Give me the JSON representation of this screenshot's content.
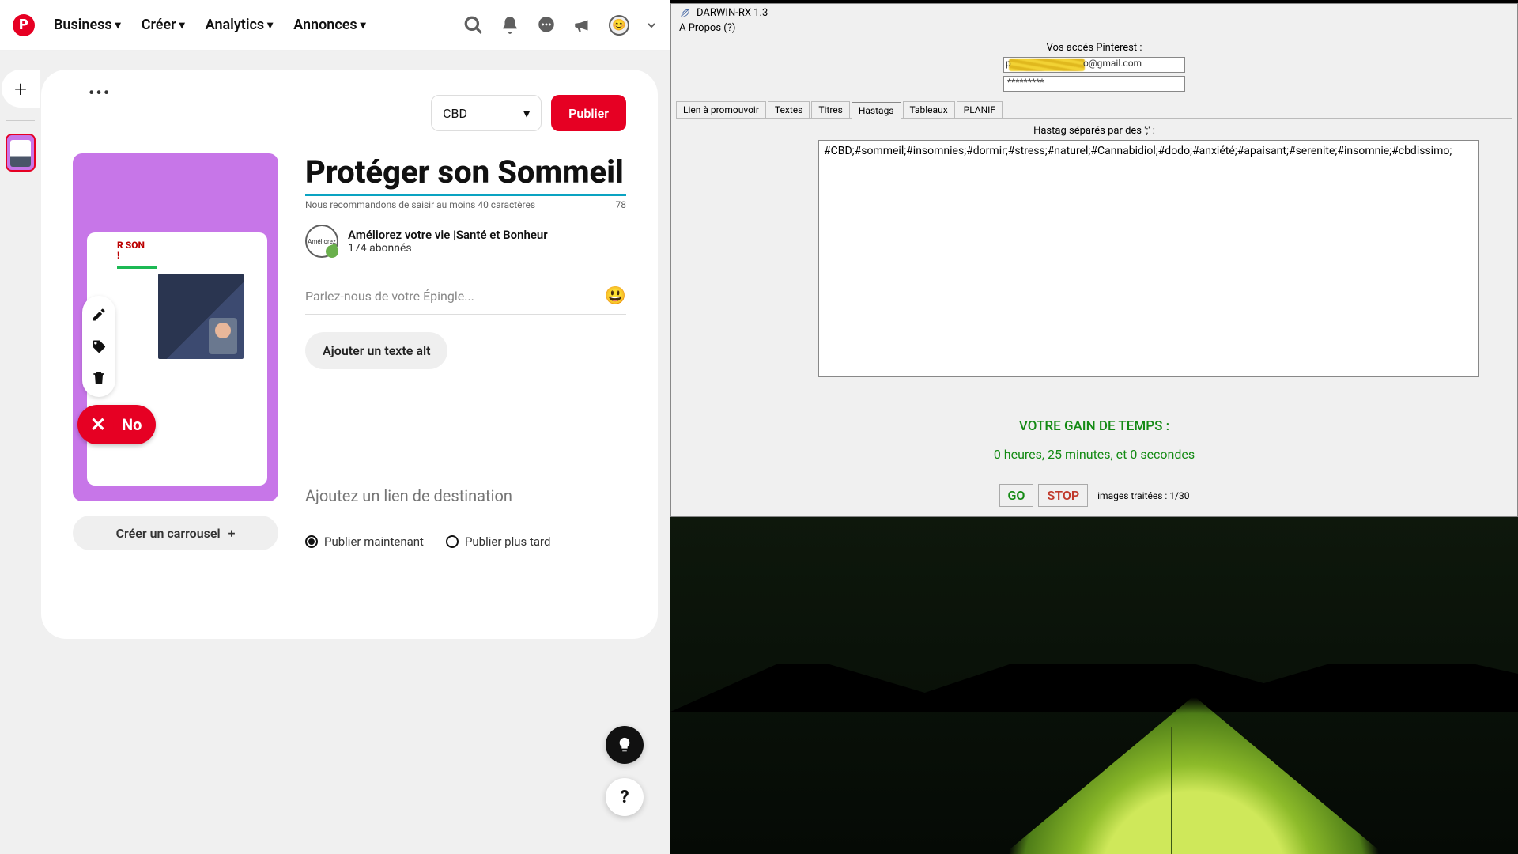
{
  "pinterest": {
    "nav": [
      "Business",
      "Créer",
      "Analytics",
      "Annonces"
    ],
    "board_selected": "CBD",
    "publish": "Publier",
    "title": "Protéger son Sommeil !",
    "title_hint": "Nous recommandons de saisir au moins 40 caractères",
    "title_count": "78",
    "profile_name": "Améliorez votre vie |Santé et Bonheur",
    "profile_sub": "174 abonnés",
    "desc_placeholder": "Parlez-nous de votre Épingle...",
    "alt_btn": "Ajouter un texte alt",
    "link_placeholder": "Ajoutez un lien de destination",
    "pub_now": "Publier maintenant",
    "pub_later": "Publier plus tard",
    "carousel_btn": "Créer un carrousel",
    "no_label": "No",
    "preview_caption": "R SON\n!"
  },
  "darwin": {
    "app_title": "DARWIN-RX 1.3",
    "menu": "A Propos (?)",
    "access_label": "Vos accés Pinterest :",
    "email_suffix": "o@gmail.com",
    "password_mask": "*********",
    "tabs": [
      "Lien à promouvoir",
      "Textes",
      "Titres",
      "Hastags",
      "Tableaux",
      "PLANIF"
    ],
    "active_tab": "Hastags",
    "hashtag_label": "Hastag séparés par des ';'  :",
    "hashtag_text": "#CBD;#sommeil;#insomnies;#dormir;#stress;#naturel;#Cannabidiol;#dodo;#anxiété;#apaisant;#serenite;#insomnie;#cbdissimo;",
    "gain_label": "VOTRE GAIN DE TEMPS :",
    "gain_value": "0 heures, 25 minutes, et 0 secondes",
    "go": "GO",
    "stop": "STOP",
    "count": "images traitées : 1/30"
  }
}
